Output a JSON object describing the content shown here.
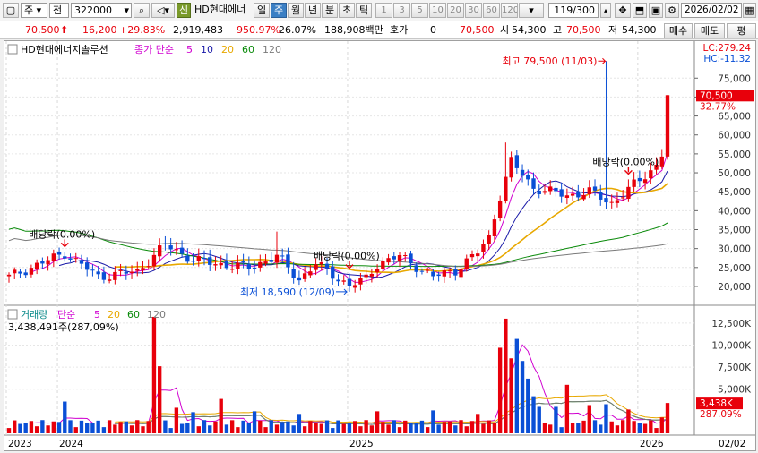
{
  "toolbar": {
    "market_label": "주",
    "mode_label": "전",
    "code_value": "322000",
    "credit_badge": "신",
    "stock_name": "HD현대에너",
    "period_tabs": [
      "일",
      "주",
      "월",
      "년",
      "분",
      "초",
      "틱"
    ],
    "active_period": "주",
    "minute_numbers": [
      "1",
      "3",
      "5",
      "10",
      "20",
      "30",
      "60",
      "120"
    ],
    "count_value": "119/300",
    "date_value": "2026/02/02"
  },
  "infobar": {
    "price": "70,500",
    "change": "16,200",
    "change_pct": "+29.83%",
    "volume": "2,919,483",
    "volume_ratio": "950.97%",
    "turnover": "26.07%",
    "amount": "188,908백만",
    "quote_label": "호가",
    "quote_value": "0",
    "price2": "70,500",
    "open_label": "시",
    "open": "54,300",
    "high_label": "고",
    "high": "70,500",
    "low_label": "저",
    "low": "54,300",
    "buy_button": "매수",
    "sell_button": "매도",
    "eval_button": "평"
  },
  "colors": {
    "up": "#e8000b",
    "down": "#0a4fd6",
    "ma5": "#d000d0",
    "ma10": "#1a1aa8",
    "ma20": "#e8a800",
    "ma60": "#0a8a0a",
    "ma120": "#7a7a7a"
  },
  "chart_data": {
    "type": "candlestick",
    "price_panel": {
      "title": "HD현대에너지솔루션",
      "legend": {
        "label": "종가 단순",
        "periods": [
          "5",
          "10",
          "20",
          "60",
          "120"
        ]
      },
      "y_ticks": [
        20000,
        25000,
        30000,
        35000,
        40000,
        45000,
        50000,
        55000,
        60000,
        65000,
        70000,
        75000
      ],
      "y_tick_labels": [
        "20,000",
        "25,000",
        "30,000",
        "35,000",
        "40,000",
        "45,000",
        "50,000",
        "55,000",
        "60,000",
        "65,000",
        "70,000",
        "75,000"
      ],
      "ylim": [
        15500,
        80500
      ],
      "lc": "LC:279.24",
      "hc": "HC:-11.32",
      "current_label": "70,500",
      "current_pct": "32.77%",
      "annotations": [
        {
          "text": "최고 79,500 (11/03)",
          "value": 79500
        },
        {
          "text": "최저 18,590 (12/09)",
          "value": 18590
        },
        {
          "text": "배당락(0.00%)"
        },
        {
          "text": "배당락(0.00%)"
        },
        {
          "text": "배당락(0.00%)"
        }
      ]
    },
    "volume_panel": {
      "legend": {
        "title": "거래량",
        "label": "단순",
        "periods": [
          "5",
          "20",
          "60",
          "120"
        ]
      },
      "last_label": "3,438,491주(287,09%)",
      "y_ticks": [
        5000,
        7500,
        10000,
        12500
      ],
      "y_tick_labels": [
        "5,000K",
        "7,500K",
        "10,000K",
        "12,500K"
      ],
      "ylim": [
        0,
        13500
      ],
      "current_label": "3,438K",
      "current_pct": "287.09%"
    },
    "x_labels": [
      "2023",
      "2024",
      "2025",
      "2026"
    ],
    "x_tail_label": "02/02"
  }
}
